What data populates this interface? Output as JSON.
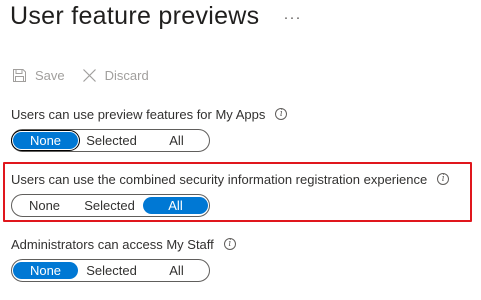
{
  "page": {
    "title": "User feature previews",
    "more_label": "···"
  },
  "toolbar": {
    "save_label": "Save",
    "discard_label": "Discard"
  },
  "settings": [
    {
      "label": "Users can use preview features for My Apps",
      "info": "i",
      "options": [
        "None",
        "Selected",
        "All"
      ],
      "selected": "None"
    },
    {
      "label": "Users can use the combined security information registration experience",
      "info": "i",
      "options": [
        "None",
        "Selected",
        "All"
      ],
      "selected": "All"
    },
    {
      "label": "Administrators can access My Staff",
      "info": "i",
      "options": [
        "None",
        "Selected",
        "All"
      ],
      "selected": "None"
    }
  ],
  "colors": {
    "accent": "#0078d4",
    "highlight_border": "#e0171d",
    "disabled_text": "#a19f9d"
  }
}
